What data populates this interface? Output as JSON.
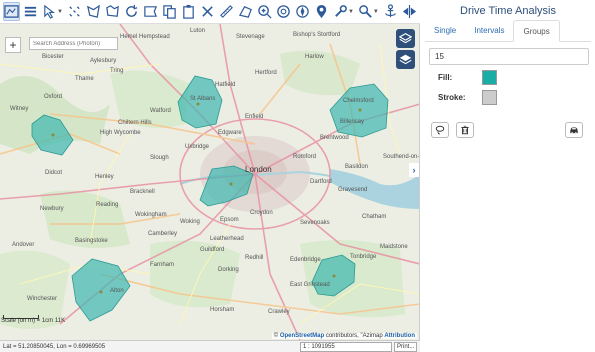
{
  "toolbar": {
    "icons": [
      "map-layers-icon",
      "stack-icon",
      "select-pointer-icon",
      "scatter-points-icon",
      "polygon-icon",
      "draw-shape-icon",
      "refresh-icon",
      "map-flag-icon",
      "copy-icon",
      "clipboard-icon",
      "clear-icon",
      "ruler-icon",
      "area-measure-icon",
      "zoom-in-icon",
      "zoom-area-icon",
      "compass-icon",
      "location-marker-icon",
      "wrench-icon",
      "search-zoom-icon",
      "anchor-icon",
      "split-icon"
    ]
  },
  "map": {
    "search_placeholder": "Search Address (Photon)",
    "zoom_plus": "+",
    "places": [
      {
        "name": "London",
        "big": true
      },
      {
        "name": "Hemel Hempstead"
      },
      {
        "name": "Watford"
      },
      {
        "name": "St Albans"
      },
      {
        "name": "Harlow"
      },
      {
        "name": "Chelmsford"
      },
      {
        "name": "Oxford"
      },
      {
        "name": "Reading"
      },
      {
        "name": "Wokingham"
      },
      {
        "name": "Guildford"
      },
      {
        "name": "Basingstoke"
      },
      {
        "name": "Winchester"
      },
      {
        "name": "Crawley"
      },
      {
        "name": "Tonbridge"
      },
      {
        "name": "Sevenoaks"
      },
      {
        "name": "Maidstone"
      },
      {
        "name": "Southend-on-Sea"
      },
      {
        "name": "Woking"
      },
      {
        "name": "Slough"
      },
      {
        "name": "High Wycombe"
      },
      {
        "name": "Didcot"
      },
      {
        "name": "Aylesbury"
      },
      {
        "name": "Luton"
      },
      {
        "name": "Stevenage"
      },
      {
        "name": "Brentwood"
      },
      {
        "name": "Dartford"
      },
      {
        "name": "Croydon"
      },
      {
        "name": "Epsom"
      },
      {
        "name": "Redhill"
      },
      {
        "name": "East Grinstead"
      },
      {
        "name": "Horsham"
      },
      {
        "name": "Farnham"
      },
      {
        "name": "Andover"
      },
      {
        "name": "Newbury"
      },
      {
        "name": "Thame"
      },
      {
        "name": "Witney"
      },
      {
        "name": "Henley"
      },
      {
        "name": "Bracknell"
      },
      {
        "name": "Camberley"
      },
      {
        "name": "Alton"
      },
      {
        "name": "Uxbridge"
      },
      {
        "name": "Edgware"
      },
      {
        "name": "Enfield"
      },
      {
        "name": "Romford"
      },
      {
        "name": "Gravesend"
      },
      {
        "name": "Chatham"
      },
      {
        "name": "Billericay"
      },
      {
        "name": "Basildon"
      },
      {
        "name": "Hertford"
      },
      {
        "name": "Bishop's Stortford"
      },
      {
        "name": "Edenbridge"
      },
      {
        "name": "Dorking"
      },
      {
        "name": "Leatherhead"
      },
      {
        "name": "Hatfield"
      },
      {
        "name": "Chiltern Hills"
      },
      {
        "name": "Tring"
      },
      {
        "name": "Bicester"
      }
    ],
    "scale_text": "Scale (on  m) = 1cm  11K",
    "attribution_prefix": "©",
    "attribution_osm": "OpenStreetMap",
    "attribution_rest": " contributors, \"Azimap",
    "attribution_link": "Attribution"
  },
  "statusbar": {
    "coords": "Lat = 51.20850045, Lon = 0.69969505",
    "scale": "1 : 1091955",
    "print": "Print..."
  },
  "panel": {
    "title": "Drive Time Analysis",
    "tabs": [
      "Single",
      "Intervals",
      "Groups"
    ],
    "active_tab": "Groups",
    "time_value": "15",
    "fill_label": "Fill:",
    "stroke_label": "Stroke:",
    "fill_color": "#1aada6",
    "stroke_color": "#cccccc"
  },
  "colors": {
    "polygon_fill": "#3fb8b0",
    "accent": "#2d4f7a",
    "link": "#2d6db5"
  }
}
